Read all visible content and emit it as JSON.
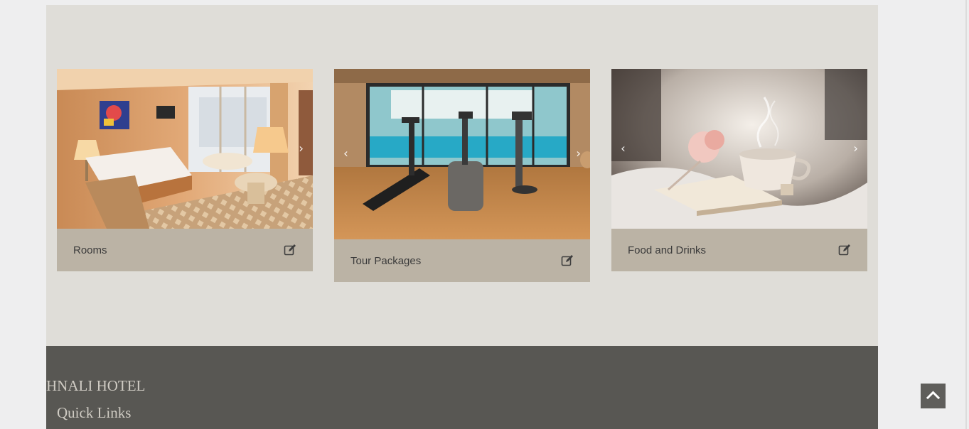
{
  "cards": [
    {
      "title": "Rooms",
      "image": "hotel-room-photo",
      "has_left_arrow": false,
      "has_right_arrow": true
    },
    {
      "title": "Tour Packages",
      "image": "gym-pool-photo",
      "has_left_arrow": true,
      "has_right_arrow": true
    },
    {
      "title": "Food and Drinks",
      "image": "tea-book-photo",
      "has_left_arrow": true,
      "has_right_arrow": true
    }
  ],
  "icons": {
    "prev": "chevron-left-icon",
    "next": "chevron-right-icon",
    "edit": "edit-icon",
    "back_to_top": "chevron-up-icon"
  },
  "carousel": {
    "prev_glyph": "‹",
    "next_glyph": "›"
  },
  "footer": {
    "hotel_name": "HNALI HOTEL",
    "quick_links_heading": "Quick Links"
  },
  "colors": {
    "section_bg": "#dfddd8",
    "card_footer_bg": "#bbb3a5",
    "footer_bg": "#585753",
    "back_to_top_bg": "#5f5e5b"
  }
}
